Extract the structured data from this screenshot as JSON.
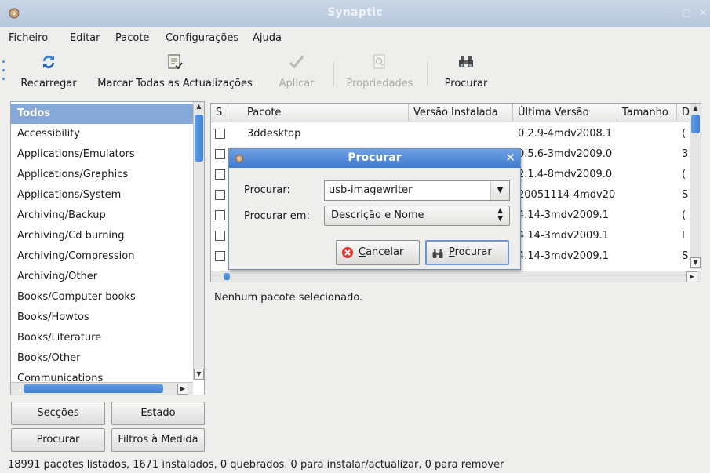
{
  "window": {
    "title": "Synaptic"
  },
  "menu": [
    {
      "label": "Ficheiro",
      "u": "F",
      "rest": "icheiro"
    },
    {
      "label": "Editar",
      "u": "E",
      "rest": "ditar"
    },
    {
      "label": "Pacote",
      "u": "P",
      "rest": "acote"
    },
    {
      "label": "Configurações",
      "u": "C",
      "rest": "onfigurações"
    },
    {
      "label": "Ajuda",
      "u": "",
      "rest": "Ajuda"
    }
  ],
  "toolbar": {
    "reload": "Recarregar",
    "mark_all": "Marcar Todas as Actualizações",
    "apply": "Aplicar",
    "properties": "Propriedades",
    "search": "Procurar"
  },
  "categories": {
    "selected": "Todos",
    "items": [
      "Accessibility",
      "Applications/Emulators",
      "Applications/Graphics",
      "Applications/System",
      "Archiving/Backup",
      "Archiving/Cd burning",
      "Archiving/Compression",
      "Archiving/Other",
      "Books/Computer books",
      "Books/Howtos",
      "Books/Literature",
      "Books/Other",
      "Communications"
    ]
  },
  "left_buttons": {
    "sections": "Secções",
    "status": "Estado",
    "search": "Procurar",
    "custom_filters": "Filtros à Medida"
  },
  "table": {
    "columns": [
      "S",
      "Pacote",
      "Versão Instalada",
      "Última Versão",
      "Tamanho",
      "D"
    ],
    "rows": [
      {
        "name": "3ddesktop",
        "installed": "",
        "latest": "0.2.9-4mdv2008.1",
        "size": "",
        "d": "("
      },
      {
        "name": "",
        "installed": "",
        "latest": "0.5.6-3mdv2009.0",
        "size": "",
        "d": "3"
      },
      {
        "name": "",
        "installed": "",
        "latest": "2.1.4-8mdv2009.0",
        "size": "",
        "d": "("
      },
      {
        "name": "",
        "installed": "",
        "latest": "20051114-4mdv20",
        "size": "",
        "d": "S"
      },
      {
        "name": "",
        "installed": "",
        "latest": "4.14-3mdv2009.1",
        "size": "",
        "d": "("
      },
      {
        "name": "",
        "installed": "",
        "latest": "4.14-3mdv2009.1",
        "size": "",
        "d": "I"
      },
      {
        "name": "",
        "installed": "",
        "latest": "4.14-3mdv2009.1",
        "size": "",
        "d": "S"
      }
    ]
  },
  "description": {
    "text": "Nenhum pacote selecionado."
  },
  "status": {
    "text": "18991 pacotes listados, 1671 instalados, 0 quebrados. 0 para instalar/actualizar, 0 para remover"
  },
  "dialog": {
    "title": "Procurar",
    "search_label": "Procurar:",
    "search_value": "usb-imagewriter",
    "search_in_label": "Procurar em:",
    "search_in_value": "Descrição e Nome",
    "cancel": "Cancelar",
    "search_button": "Procurar"
  },
  "colors": {
    "selection": "#86a8d9",
    "dialog_title": "#4f86d6",
    "scroll_thumb": "#4a8ddb"
  }
}
